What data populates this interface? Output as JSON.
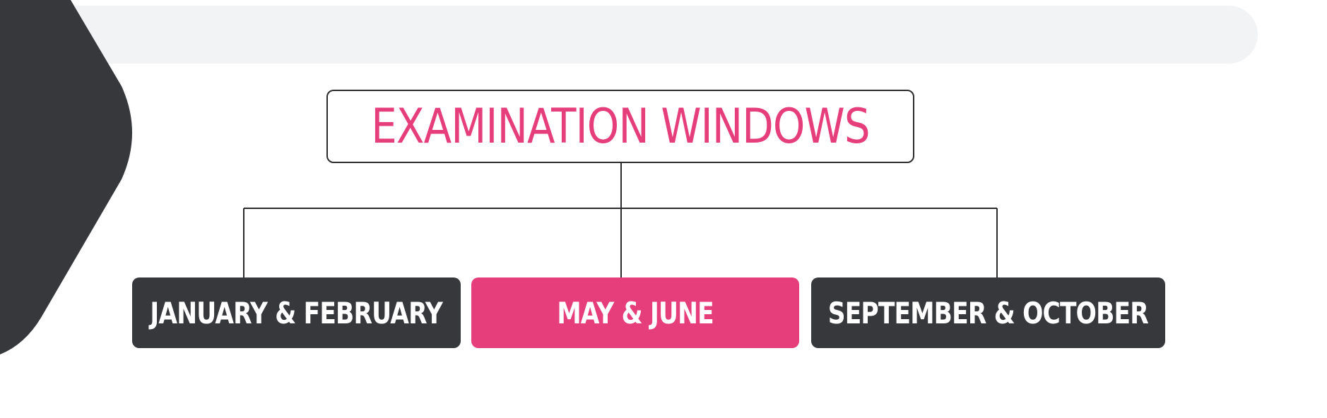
{
  "title": "EXAMINATION WINDOWS",
  "windows": [
    {
      "label": "JANUARY & FEBRUARY",
      "style": "dark"
    },
    {
      "label": "MAY & JUNE",
      "style": "accent"
    },
    {
      "label": "SEPTEMBER & OCTOBER",
      "style": "dark"
    }
  ],
  "colors": {
    "accent": "#e63e7b",
    "dark": "#36383b",
    "top_bar": "#f2f3f5"
  }
}
